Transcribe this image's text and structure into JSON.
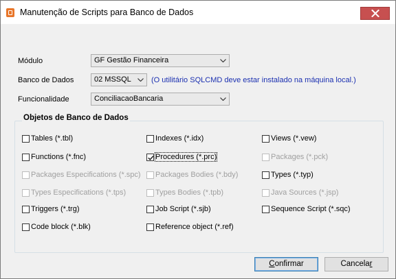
{
  "window": {
    "title": "Manutenção de Scripts para Banco de Dados",
    "icon": "scripts-app-icon",
    "colors": {
      "close_button": "#c75050",
      "hint_text": "#1a2fb0"
    }
  },
  "form": {
    "modulo": {
      "label": "Módulo",
      "value": "GF  Gestão Financeira"
    },
    "banco": {
      "label": "Banco de Dados",
      "value": "02 MSSQL",
      "hint": "(O utilitário SQLCMD deve estar instalado na máquina local.)"
    },
    "funcionalidade": {
      "label": "Funcionalidade",
      "value": "ConciliacaoBancaria"
    }
  },
  "objects": {
    "title": "Objetos de Banco de Dados",
    "items": [
      {
        "label": "Tables (*.tbl)",
        "checked": false,
        "disabled": false
      },
      {
        "label": "Indexes (*.idx)",
        "checked": false,
        "disabled": false
      },
      {
        "label": "Views (*.vew)",
        "checked": false,
        "disabled": false
      },
      {
        "label": "Functions (*.fnc)",
        "checked": false,
        "disabled": false
      },
      {
        "label": "Procedures (*.prc)",
        "checked": true,
        "disabled": false
      },
      {
        "label": "Packages (*.pck)",
        "checked": false,
        "disabled": true
      },
      {
        "label": "Packages Especifications (*.spc)",
        "checked": false,
        "disabled": true
      },
      {
        "label": "Packages Bodies (*.bdy)",
        "checked": false,
        "disabled": true
      },
      {
        "label": "Types (*.typ)",
        "checked": false,
        "disabled": false
      },
      {
        "label": "Types Especifications (*.tps)",
        "checked": false,
        "disabled": true
      },
      {
        "label": "Types Bodies (*.tpb)",
        "checked": false,
        "disabled": true
      },
      {
        "label": "Java Sources (*.jsp)",
        "checked": false,
        "disabled": true
      },
      {
        "label": "Triggers (*.trg)",
        "checked": false,
        "disabled": false
      },
      {
        "label": "Job Script (*.sjb)",
        "checked": false,
        "disabled": false
      },
      {
        "label": "Sequence Script (*.sqc)",
        "checked": false,
        "disabled": false
      },
      {
        "label": "Code block (*.blk)",
        "checked": false,
        "disabled": false
      },
      {
        "label": "Reference object (*.ref)",
        "checked": false,
        "disabled": false
      }
    ]
  },
  "buttons": {
    "confirm": {
      "label": "Confirmar",
      "accel": "C",
      "rest": "onfirmar"
    },
    "cancel": {
      "label": "Cancelar",
      "accel": "l",
      "pre": "Cancela",
      "post": "r"
    }
  }
}
